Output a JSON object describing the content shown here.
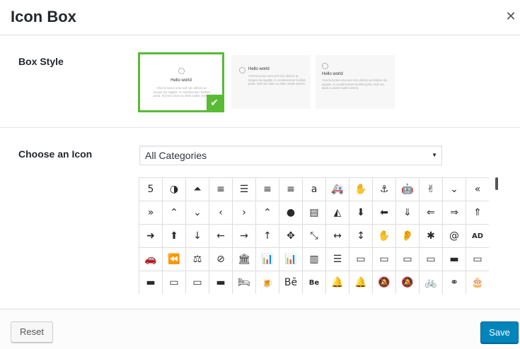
{
  "dialog": {
    "title": "Icon Box",
    "close_glyph": "✕"
  },
  "box_style": {
    "label": "Box Style",
    "selected_index": 0,
    "check_glyph": "✔",
    "cards": [
      {
        "title": "Hello world",
        "text": "Viverra luctus urna sed rum ultrices ac tempor dui sagittis. In condimentum facilisis porta. Sed nec diam eu diam mattis viverra."
      },
      {
        "title": "Hello world",
        "text": "Viverra luctus urna sed rum ultrices ac tempor dui sagittis. In condimentum facilisis porta. Sed nec diam eu diam mattis viverra."
      },
      {
        "title": "Hello world",
        "text": "Viverra luctus urna sed rum ultrices ac tempor dui sagittis. In condimentum facilisis porta. Sed nec diam eu diam mattis viverra."
      }
    ]
  },
  "choose_icon": {
    "label": "Choose an Icon",
    "category_selected": "All Categories",
    "dropdown_arrow": "▼",
    "icons": [
      {
        "name": "500px-icon",
        "glyph": "5"
      },
      {
        "name": "adjust-icon",
        "glyph": "◑"
      },
      {
        "name": "chevron-circle-up-icon",
        "glyph": "⏶"
      },
      {
        "name": "align-center-icon",
        "glyph": "≡"
      },
      {
        "name": "align-justify-icon",
        "glyph": "☰"
      },
      {
        "name": "align-left-icon",
        "glyph": "≡"
      },
      {
        "name": "align-right-icon",
        "glyph": "≡"
      },
      {
        "name": "amazon-icon",
        "glyph": "a"
      },
      {
        "name": "ambulance-icon",
        "glyph": "🚑"
      },
      {
        "name": "sign-language-icon",
        "glyph": "✋"
      },
      {
        "name": "anchor-icon",
        "glyph": "⚓"
      },
      {
        "name": "android-icon",
        "glyph": "🤖"
      },
      {
        "name": "hand-peace-icon",
        "glyph": "✌"
      },
      {
        "name": "angle-double-down-icon",
        "glyph": "⌄"
      },
      {
        "name": "angle-double-left-icon",
        "glyph": "«"
      },
      {
        "name": "angle-double-right-icon",
        "glyph": "»"
      },
      {
        "name": "angle-double-up-icon",
        "glyph": "⌃"
      },
      {
        "name": "angle-down-icon",
        "glyph": "⌄"
      },
      {
        "name": "angle-left-icon",
        "glyph": "‹"
      },
      {
        "name": "angle-right-icon",
        "glyph": "›"
      },
      {
        "name": "angle-up-icon",
        "glyph": "⌃"
      },
      {
        "name": "apple-icon",
        "glyph": "●"
      },
      {
        "name": "archive-icon",
        "glyph": "▤"
      },
      {
        "name": "area-chart-icon",
        "glyph": "◭"
      },
      {
        "name": "arrow-circle-down-icon",
        "glyph": "⬇"
      },
      {
        "name": "arrow-circle-left-icon",
        "glyph": "⬅"
      },
      {
        "name": "arrow-circle-o-down-icon",
        "glyph": "⇓"
      },
      {
        "name": "arrow-circle-o-left-icon",
        "glyph": "⇐"
      },
      {
        "name": "arrow-circle-o-right-icon",
        "glyph": "⇒"
      },
      {
        "name": "arrow-circle-o-up-icon",
        "glyph": "⇑"
      },
      {
        "name": "arrow-circle-right-icon",
        "glyph": "➜"
      },
      {
        "name": "arrow-circle-up-icon",
        "glyph": "⬆"
      },
      {
        "name": "arrow-down-icon",
        "glyph": "↓"
      },
      {
        "name": "arrow-left-icon",
        "glyph": "←"
      },
      {
        "name": "arrow-right-icon",
        "glyph": "→"
      },
      {
        "name": "arrow-up-icon",
        "glyph": "↑"
      },
      {
        "name": "arrows-icon",
        "glyph": "✥"
      },
      {
        "name": "arrows-alt-icon",
        "glyph": "⤡"
      },
      {
        "name": "arrows-h-icon",
        "glyph": "↔"
      },
      {
        "name": "arrows-v-icon",
        "glyph": "↕"
      },
      {
        "name": "asl-interpreting-icon",
        "glyph": "✋"
      },
      {
        "name": "deaf-icon",
        "glyph": "👂"
      },
      {
        "name": "asterisk-icon",
        "glyph": "✱"
      },
      {
        "name": "at-icon",
        "glyph": "@"
      },
      {
        "name": "audio-description-icon",
        "glyph": "AD"
      },
      {
        "name": "car-icon",
        "glyph": "🚗"
      },
      {
        "name": "backward-icon",
        "glyph": "⏪"
      },
      {
        "name": "balance-scale-icon",
        "glyph": "⚖"
      },
      {
        "name": "ban-icon",
        "glyph": "⊘"
      },
      {
        "name": "bank-icon",
        "glyph": "🏛"
      },
      {
        "name": "bar-chart-icon",
        "glyph": "📊"
      },
      {
        "name": "bar-chart-o-icon",
        "glyph": "📊"
      },
      {
        "name": "barcode-icon",
        "glyph": "▥"
      },
      {
        "name": "bars-icon",
        "glyph": "☰"
      },
      {
        "name": "battery-empty-icon",
        "glyph": "▭"
      },
      {
        "name": "battery-quarter-icon",
        "glyph": "▭"
      },
      {
        "name": "battery-half-icon",
        "glyph": "▭"
      },
      {
        "name": "battery-three-quarters-icon",
        "glyph": "▭"
      },
      {
        "name": "battery-full-icon",
        "glyph": "▬"
      },
      {
        "name": "battery-empty-alt-icon",
        "glyph": "▭"
      },
      {
        "name": "battery-full-alt-icon",
        "glyph": "▬"
      },
      {
        "name": "battery-quarter-alt-icon",
        "glyph": "▭"
      },
      {
        "name": "battery-quarter-alt2-icon",
        "glyph": "▭"
      },
      {
        "name": "battery-half-alt-icon",
        "glyph": "▬"
      },
      {
        "name": "bed-icon",
        "glyph": "🛏"
      },
      {
        "name": "beer-icon",
        "glyph": "🍺"
      },
      {
        "name": "behance-icon",
        "glyph": "Bē"
      },
      {
        "name": "behance-square-icon",
        "glyph": "Be"
      },
      {
        "name": "bell-icon",
        "glyph": "🔔"
      },
      {
        "name": "bell-o-icon",
        "glyph": "🔔"
      },
      {
        "name": "bell-slash-icon",
        "glyph": "🔕"
      },
      {
        "name": "bell-slash-o-icon",
        "glyph": "🔕"
      },
      {
        "name": "bicycle-icon",
        "glyph": "🚲"
      },
      {
        "name": "binoculars-icon",
        "glyph": "⚭"
      },
      {
        "name": "birthday-cake-icon",
        "glyph": "🎂"
      }
    ]
  },
  "footer": {
    "reset_label": "Reset",
    "save_label": "Save"
  }
}
